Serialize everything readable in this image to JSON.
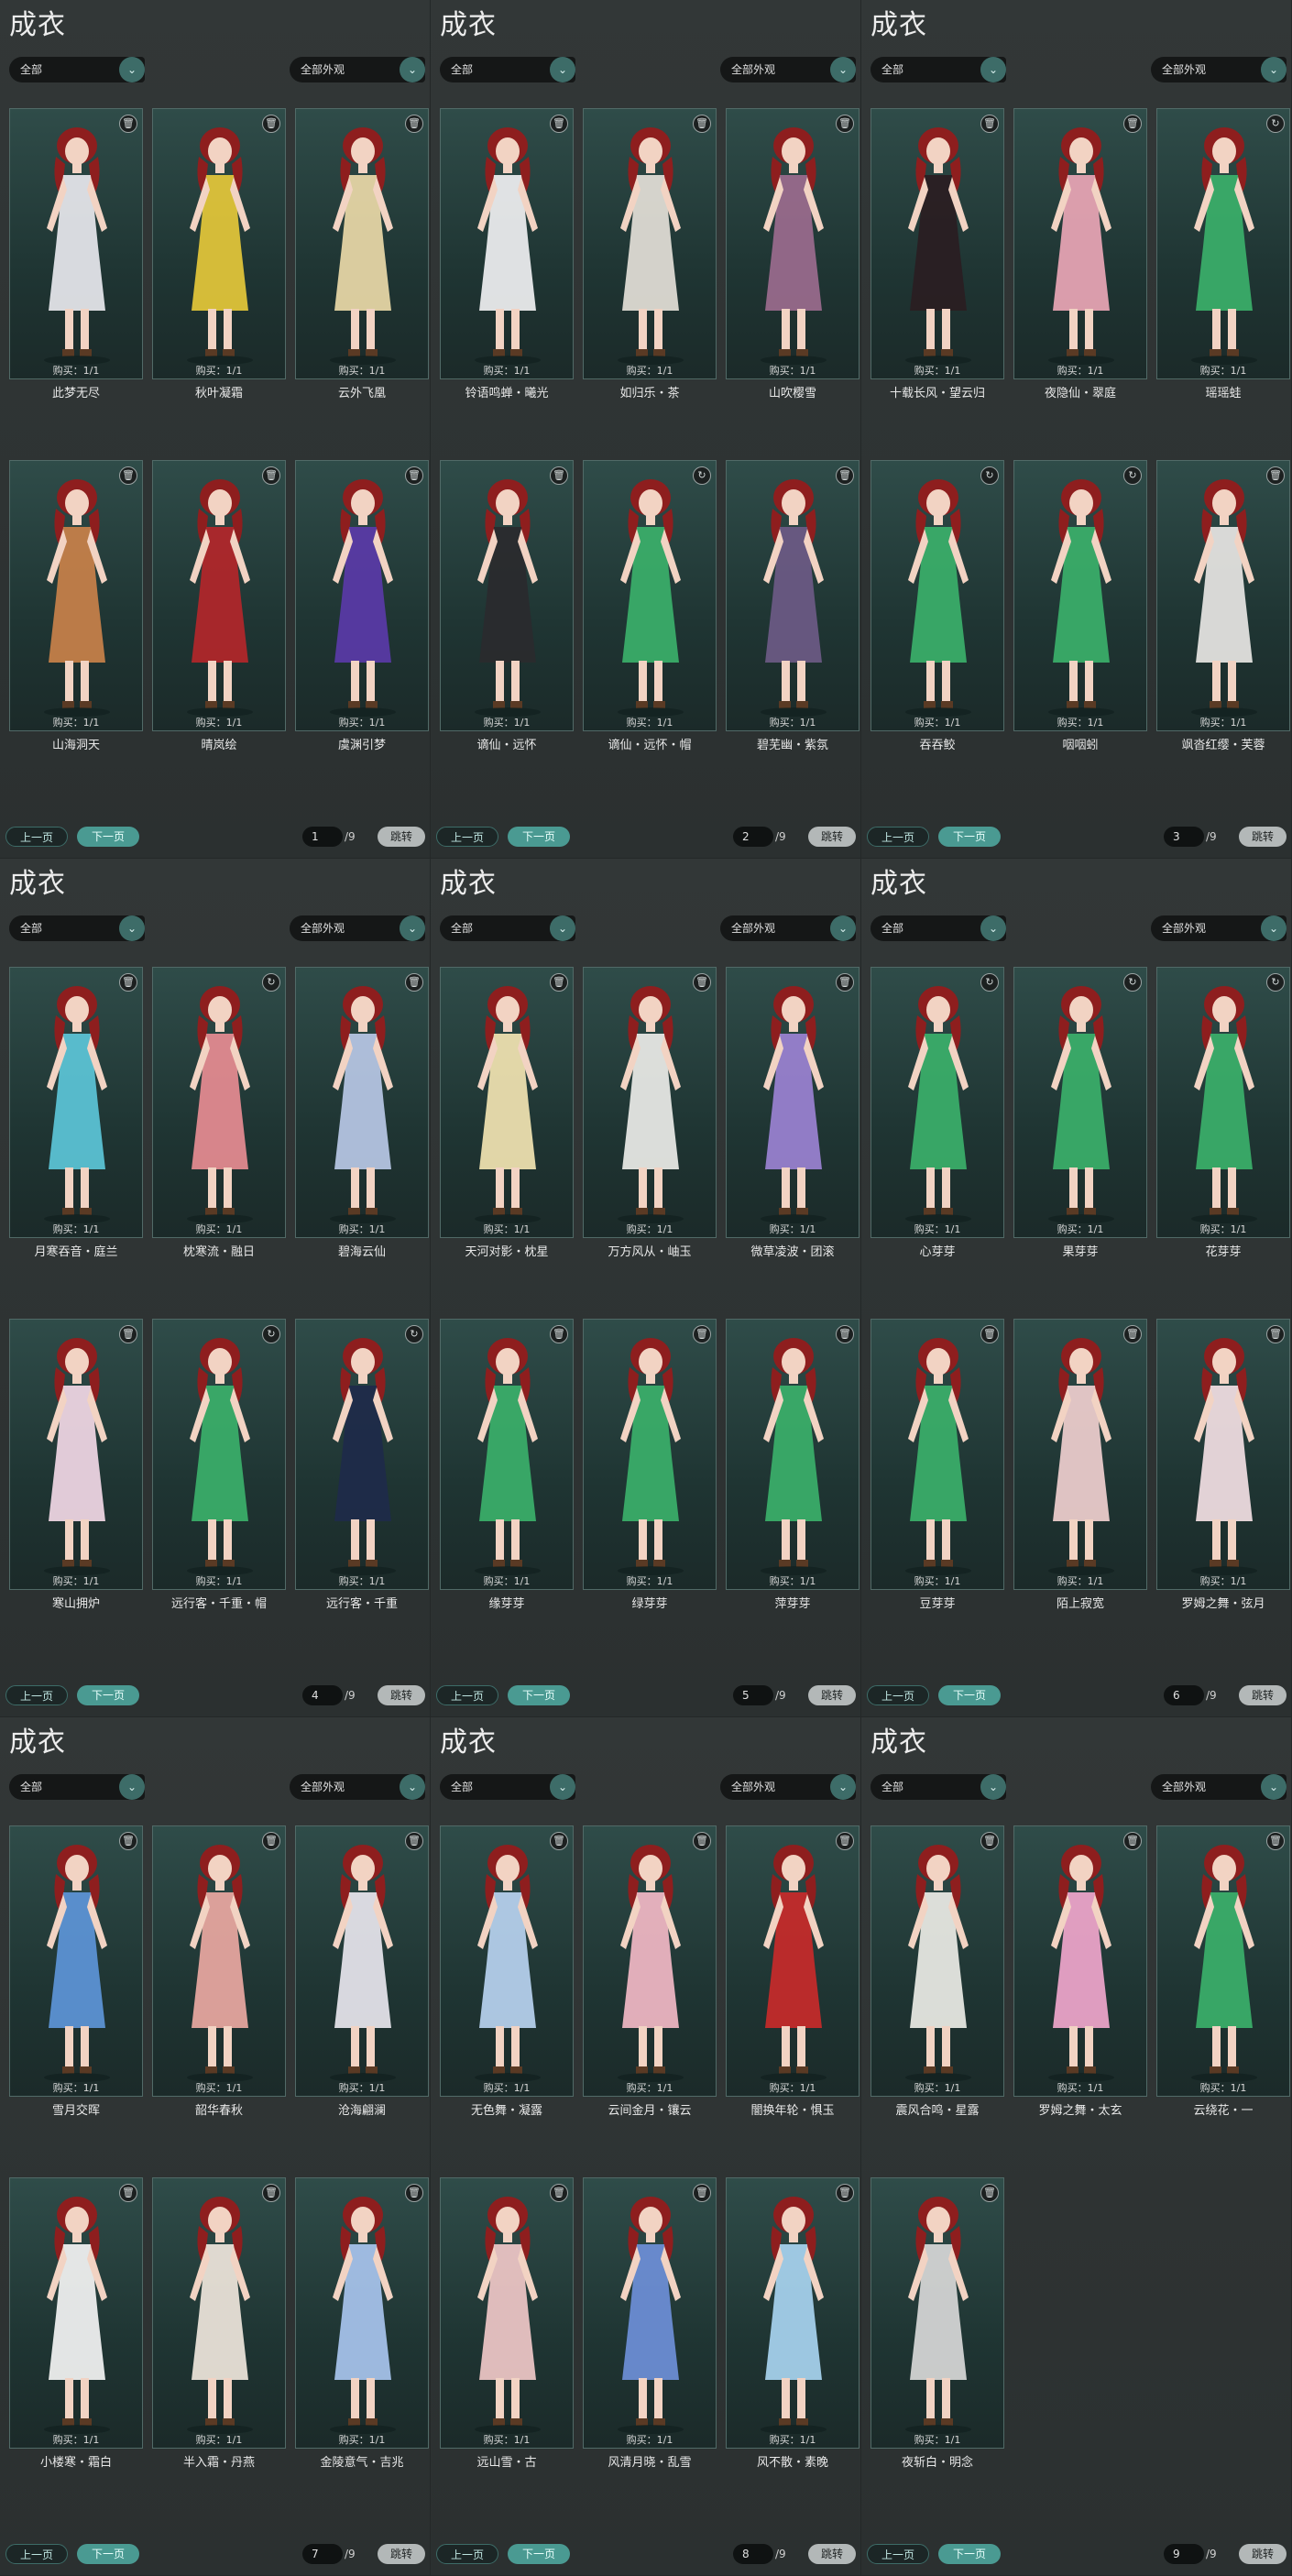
{
  "common": {
    "title": "成衣",
    "category_filter": "全部",
    "appearance_filter": "全部外观",
    "prev_label": "上一页",
    "next_label": "下一页",
    "jump_label": "跳转",
    "dropdown_icon": "chevron-down-icon"
  },
  "panels": [
    {
      "page": "1",
      "total": "/9",
      "cards": [
        {
          "name": "此梦无尽",
          "purchase": "购买：1/1",
          "badge": "trash-icon",
          "outfit": "#e8e8ee"
        },
        {
          "name": "秋叶凝霜",
          "purchase": "购买：1/1",
          "badge": "trash-icon",
          "outfit": "#e5c83a"
        },
        {
          "name": "云外飞凰",
          "purchase": "购买：1/1",
          "badge": "trash-icon",
          "outfit": "#ead9a8"
        },
        {
          "name": "山海洞天",
          "purchase": "购买：1/1",
          "badge": "trash-icon",
          "outfit": "#c9814a"
        },
        {
          "name": "晴岚绘",
          "purchase": "购买：1/1",
          "badge": "trash-icon",
          "outfit": "#b3262a"
        },
        {
          "name": "虞渊引梦",
          "purchase": "购买：1/1",
          "badge": "trash-icon",
          "outfit": "#5a3aa8"
        }
      ]
    },
    {
      "page": "2",
      "total": "/9",
      "cards": [
        {
          "name": "铃语鸣蝉・曦光",
          "purchase": "购买：1/1",
          "badge": "trash-icon",
          "outfit": "#f0f0f2"
        },
        {
          "name": "如归乐・茶",
          "purchase": "购买：1/1",
          "badge": "trash-icon",
          "outfit": "#e4e0d8"
        },
        {
          "name": "山吹樱雪",
          "purchase": "购买：1/1",
          "badge": "trash-icon",
          "outfit": "#9b6b8e"
        },
        {
          "name": "谪仙・远怀",
          "purchase": "购买：1/1",
          "badge": "trash-icon",
          "outfit": "#2a2a2e"
        },
        {
          "name": "谪仙・远怀・帽",
          "purchase": "购买：1/1",
          "badge": "refresh-icon",
          "outfit": "#3bb06a"
        },
        {
          "name": "碧芜幽・紫氛",
          "purchase": "购买：1/1",
          "badge": "trash-icon",
          "outfit": "#6c5a86"
        }
      ]
    },
    {
      "page": "3",
      "total": "/9",
      "cards": [
        {
          "name": "十载长风・望云归",
          "purchase": "购买：1/1",
          "badge": "trash-icon",
          "outfit": "#2a1d22"
        },
        {
          "name": "夜隐仙・翠庭",
          "purchase": "购买：1/1",
          "badge": "trash-icon",
          "outfit": "#eaa6b6"
        },
        {
          "name": "瑶瑶蛙",
          "purchase": "购买：1/1",
          "badge": "refresh-icon",
          "outfit": "#3bb06a"
        },
        {
          "name": "吞吞鲛",
          "purchase": "购买：1/1",
          "badge": "refresh-icon",
          "outfit": "#3bb06a"
        },
        {
          "name": "咽咽蚓",
          "purchase": "购买：1/1",
          "badge": "refresh-icon",
          "outfit": "#3bb06a"
        },
        {
          "name": "飒沓红缨・芙蓉",
          "purchase": "购买：1/1",
          "badge": "trash-icon",
          "outfit": "#e8e6e4"
        }
      ]
    },
    {
      "page": "4",
      "total": "/9",
      "cards": [
        {
          "name": "月寒吞音・庭兰",
          "purchase": "购买：1/1",
          "badge": "trash-icon",
          "outfit": "#5cc6d8"
        },
        {
          "name": "枕寒流・融日",
          "purchase": "购买：1/1",
          "badge": "refresh-icon",
          "outfit": "#e78c92"
        },
        {
          "name": "碧海云仙",
          "purchase": "购买：1/1",
          "badge": "trash-icon",
          "outfit": "#b8c8e6"
        },
        {
          "name": "寒山拥炉",
          "purchase": "购买：1/1",
          "badge": "trash-icon",
          "outfit": "#f2d8e6"
        },
        {
          "name": "远行客・千重・帽",
          "purchase": "购买：1/1",
          "badge": "refresh-icon",
          "outfit": "#3bb06a"
        },
        {
          "name": "远行客・千重",
          "purchase": "购买：1/1",
          "badge": "refresh-icon",
          "outfit": "#1e2a4a"
        }
      ]
    },
    {
      "page": "5",
      "total": "/9",
      "cards": [
        {
          "name": "天河对影・枕星",
          "purchase": "购买：1/1",
          "badge": "trash-icon",
          "outfit": "#f2e4b2"
        },
        {
          "name": "万方风从・岫玉",
          "purchase": "购买：1/1",
          "badge": "trash-icon",
          "outfit": "#ecece8"
        },
        {
          "name": "微草凌波・团滚",
          "purchase": "购买：1/1",
          "badge": "trash-icon",
          "outfit": "#9b82d2"
        },
        {
          "name": "缘芽芽",
          "purchase": "购买：1/1",
          "badge": "trash-icon",
          "outfit": "#3bb06a"
        },
        {
          "name": "绿芽芽",
          "purchase": "购买：1/1",
          "badge": "trash-icon",
          "outfit": "#3bb06a"
        },
        {
          "name": "萍芽芽",
          "purchase": "购买：1/1",
          "badge": "trash-icon",
          "outfit": "#3bb06a"
        }
      ]
    },
    {
      "page": "6",
      "total": "/9",
      "cards": [
        {
          "name": "心芽芽",
          "purchase": "购买：1/1",
          "badge": "refresh-icon",
          "outfit": "#3bb06a"
        },
        {
          "name": "果芽芽",
          "purchase": "购买：1/1",
          "badge": "refresh-icon",
          "outfit": "#3bb06a"
        },
        {
          "name": "花芽芽",
          "purchase": "购买：1/1",
          "badge": "refresh-icon",
          "outfit": "#3bb06a"
        },
        {
          "name": "豆芽芽",
          "purchase": "购买：1/1",
          "badge": "trash-icon",
          "outfit": "#3bb06a"
        },
        {
          "name": "陌上寂宽",
          "purchase": "购买：1/1",
          "badge": "trash-icon",
          "outfit": "#f0cfcf"
        },
        {
          "name": "罗姆之舞・弦月",
          "purchase": "购买：1/1",
          "badge": "trash-icon",
          "outfit": "#f3e0e4"
        }
      ]
    },
    {
      "page": "7",
      "total": "/9",
      "cards": [
        {
          "name": "雪月交晖",
          "purchase": "购买：1/1",
          "badge": "trash-icon",
          "outfit": "#5d95d8"
        },
        {
          "name": "韶华春秋",
          "purchase": "购买：1/1",
          "badge": "trash-icon",
          "outfit": "#eaa8a2"
        },
        {
          "name": "沧海翩澜",
          "purchase": "购买：1/1",
          "badge": "trash-icon",
          "outfit": "#e8e6ee"
        },
        {
          "name": "小楼寒・霜白",
          "purchase": "购买：1/1",
          "badge": "trash-icon",
          "outfit": "#f4f4f4"
        },
        {
          "name": "半入霜・丹燕",
          "purchase": "购买：1/1",
          "badge": "trash-icon",
          "outfit": "#efe6dc"
        },
        {
          "name": "金陵意气・吉兆",
          "purchase": "购买：1/1",
          "badge": "trash-icon",
          "outfit": "#a8c4ee"
        }
      ]
    },
    {
      "page": "8",
      "total": "/9",
      "cards": [
        {
          "name": "无色舞・凝露",
          "purchase": "购买：1/1",
          "badge": "trash-icon",
          "outfit": "#b8d2f0"
        },
        {
          "name": "云间金月・镶云",
          "purchase": "购买：1/1",
          "badge": "trash-icon",
          "outfit": "#f2b8c6"
        },
        {
          "name": "闇换年轮・惧玉",
          "purchase": "购买：1/1",
          "badge": "trash-icon",
          "outfit": "#c82a2a"
        },
        {
          "name": "远山雪・古",
          "purchase": "购买：1/1",
          "badge": "trash-icon",
          "outfit": "#f0c8c8"
        },
        {
          "name": "风清月晓・乱雪",
          "purchase": "购买：1/1",
          "badge": "trash-icon",
          "outfit": "#6e8fd8"
        },
        {
          "name": "风不散・素晚",
          "purchase": "购买：1/1",
          "badge": "trash-icon",
          "outfit": "#a8d4f0"
        }
      ]
    },
    {
      "page": "9",
      "total": "/9",
      "cards": [
        {
          "name": "震风合鸣・星露",
          "purchase": "购买：1/1",
          "badge": "trash-icon",
          "outfit": "#ecebe6"
        },
        {
          "name": "罗姆之舞・太玄",
          "purchase": "购买：1/1",
          "badge": "trash-icon",
          "outfit": "#f0a6cc"
        },
        {
          "name": "云绕花・一",
          "purchase": "购买：1/1",
          "badge": "trash-icon",
          "outfit": "#3bb06a"
        },
        {
          "name": "夜斩白・明念",
          "purchase": "购买：1/1",
          "badge": "trash-icon",
          "outfit": "#d8d8d8"
        }
      ]
    }
  ]
}
